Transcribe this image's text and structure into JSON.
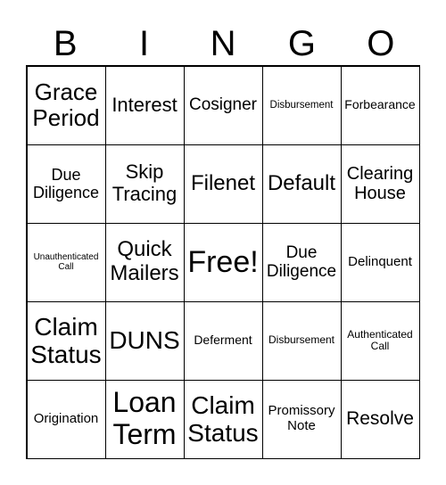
{
  "header": [
    "B",
    "I",
    "N",
    "G",
    "O"
  ],
  "cells": [
    [
      "Grace Period",
      "Interest",
      "Cosigner",
      "Disbursement",
      "Forbearance"
    ],
    [
      "Due Diligence",
      "Skip Tracing",
      "Filenet",
      "Default",
      "Clearing House"
    ],
    [
      "Unauthenticated Call",
      "Quick Mailers",
      "Free!",
      "Due Diligence",
      "Delinquent"
    ],
    [
      "Claim Status",
      "DUNS",
      "Deferment",
      "Disbursement",
      "Authenticated Call"
    ],
    [
      "Origination",
      "Loan Term",
      "Claim Status",
      "Promissory Note",
      "Resolve"
    ]
  ]
}
